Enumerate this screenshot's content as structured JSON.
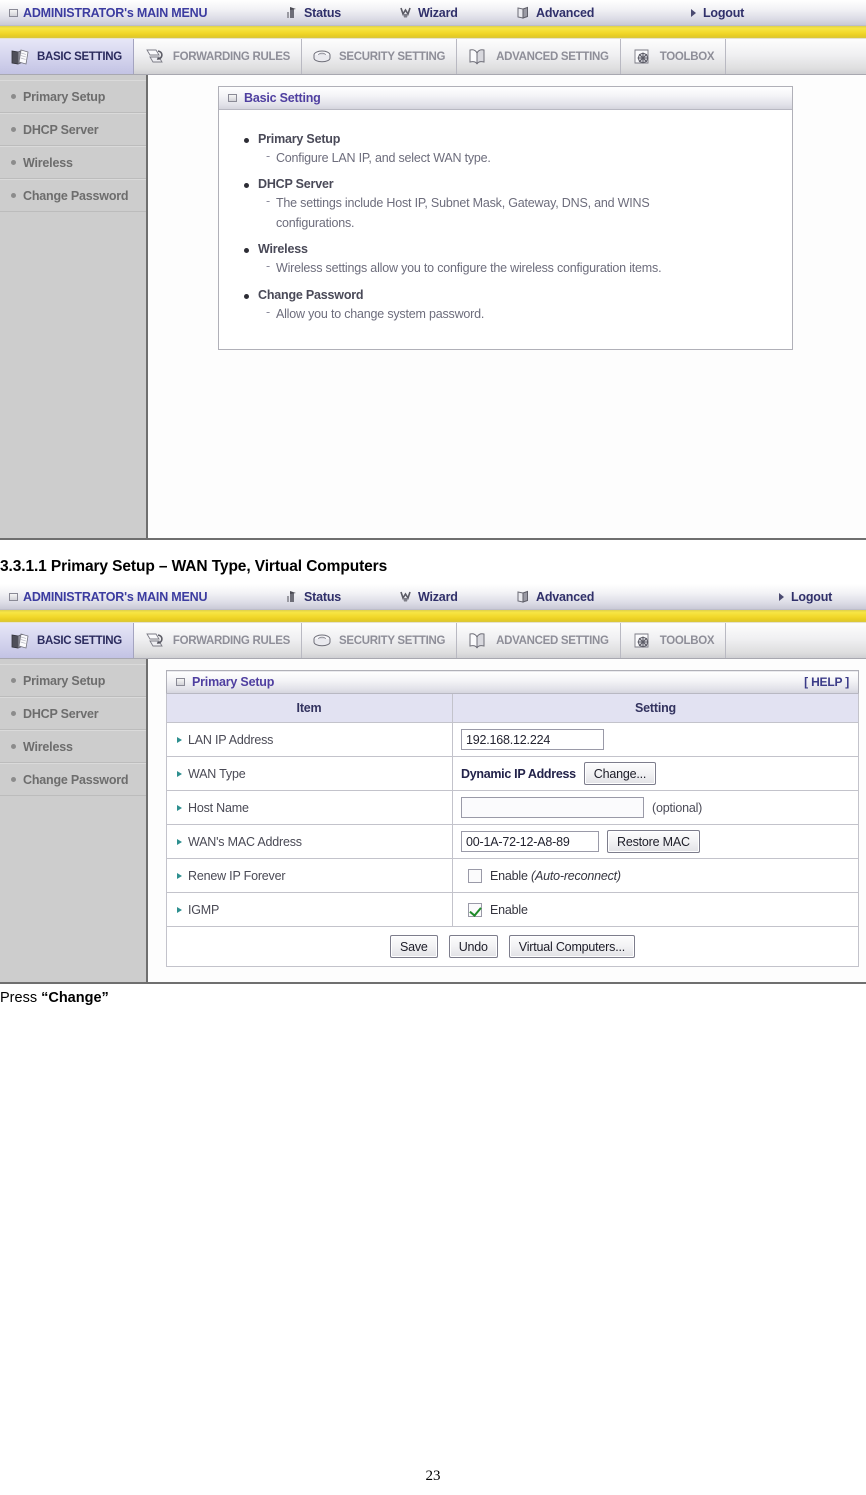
{
  "colors": {
    "accent_purple": "#3c3ca0",
    "yellow_band": "#f2d92c",
    "sidebar_bg": "#cdcdcd",
    "table_header_bg": "#e2e2f2",
    "arrow_teal": "#2e8f8f",
    "check_green": "#1f8a2a"
  },
  "topbar": {
    "main_menu": "ADMINISTRATOR's MAIN MENU",
    "items": [
      {
        "label": "Status",
        "icon": "status-bars-icon"
      },
      {
        "label": "Wizard",
        "icon": "wizard-wand-icon"
      },
      {
        "label": "Advanced",
        "icon": "advanced-book-icon"
      },
      {
        "label": "Logout",
        "icon": "arrow-right-icon"
      }
    ]
  },
  "tabs": [
    {
      "label": "BASIC SETTING",
      "icon": "books-icon",
      "active": true
    },
    {
      "label": "FORWARDING RULES",
      "icon": "forward-pages-icon",
      "active": false
    },
    {
      "label": "SECURITY SETTING",
      "icon": "shield-hex-icon",
      "active": false
    },
    {
      "label": "ADVANCED SETTING",
      "icon": "open-book-icon",
      "active": false
    },
    {
      "label": "TOOLBOX",
      "icon": "gear-tool-icon",
      "active": false
    }
  ],
  "sidebar": {
    "items": [
      {
        "label": "Primary Setup"
      },
      {
        "label": "DHCP Server"
      },
      {
        "label": "Wireless"
      },
      {
        "label": "Change Password"
      }
    ]
  },
  "screen1": {
    "panel_title": "Basic Setting",
    "features": [
      {
        "name": "Primary Setup",
        "desc": "Configure LAN IP, and select WAN type."
      },
      {
        "name": "DHCP Server",
        "desc": "The settings include Host IP, Subnet Mask, Gateway, DNS, and WINS configurations."
      },
      {
        "name": "Wireless",
        "desc": "Wireless settings allow you to configure the wireless configuration items."
      },
      {
        "name": "Change Password",
        "desc": "Allow you to change system password."
      }
    ]
  },
  "section_heading": "3.3.1.1 Primary Setup – WAN Type, Virtual Computers",
  "screen2": {
    "panel_title": "Primary Setup",
    "help_label": "[ HELP ]",
    "columns": {
      "item": "Item",
      "setting": "Setting"
    },
    "rows": [
      {
        "item": "LAN IP Address",
        "type": "text",
        "value": "192.168.12.224",
        "placeholder": ""
      },
      {
        "item": "WAN Type",
        "type": "value-button",
        "value": "Dynamic IP Address",
        "button": "Change..."
      },
      {
        "item": "Host Name",
        "type": "text-note",
        "value": "",
        "placeholder": "",
        "note": "(optional)"
      },
      {
        "item": "WAN's MAC Address",
        "type": "text-button",
        "value": "00-1A-72-12-A8-89",
        "button": "Restore MAC"
      },
      {
        "item": "Renew IP Forever",
        "type": "checkbox",
        "checked": false,
        "label": "Enable ",
        "label_italic": "(Auto-reconnect)"
      },
      {
        "item": "IGMP",
        "type": "checkbox",
        "checked": true,
        "label": "Enable",
        "label_italic": ""
      }
    ],
    "actions": [
      {
        "label": "Save"
      },
      {
        "label": "Undo"
      },
      {
        "label": "Virtual Computers..."
      }
    ]
  },
  "caption": {
    "prefix": "Press ",
    "quoted": "“Change”"
  },
  "page_number": "23"
}
